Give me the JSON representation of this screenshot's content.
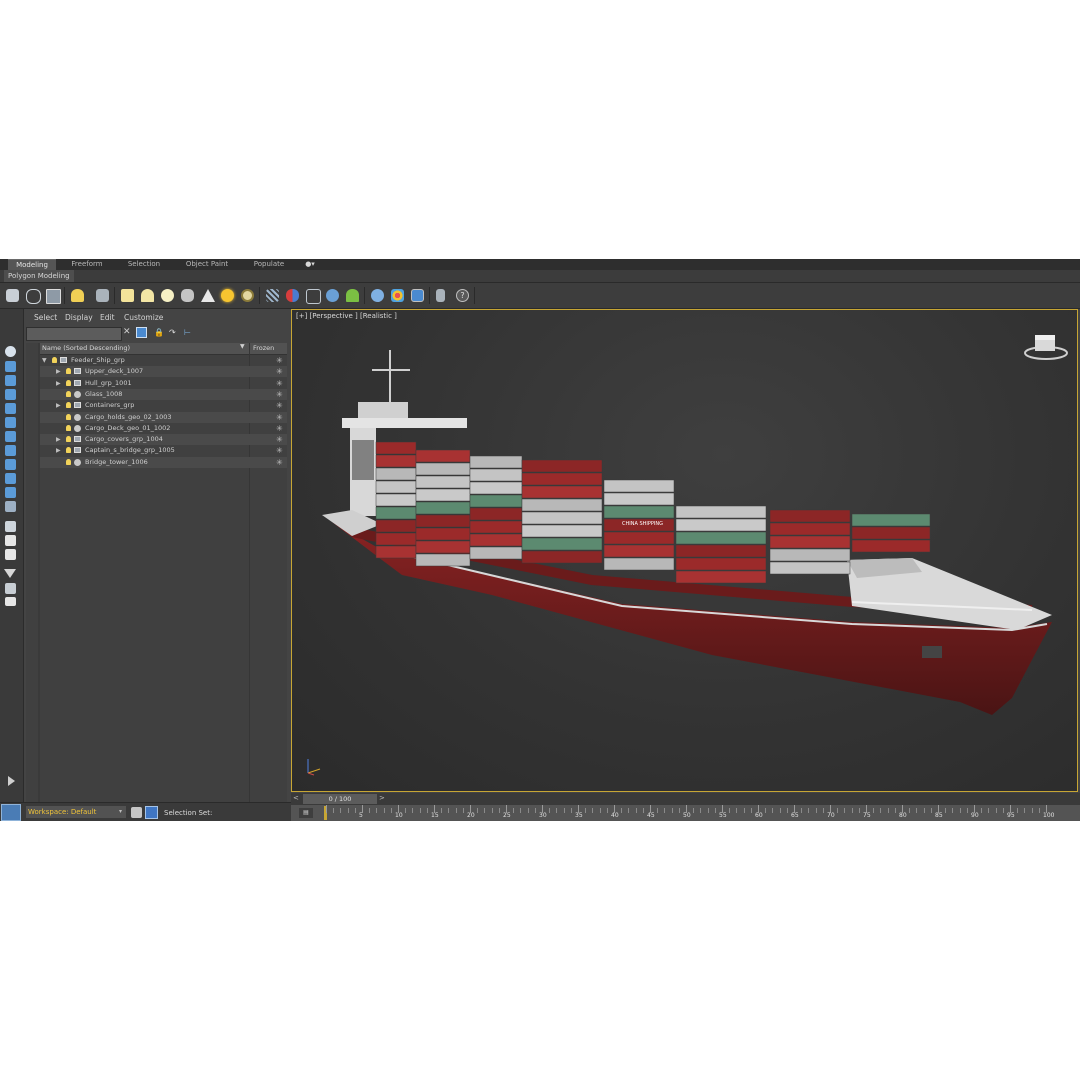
{
  "ribbon": {
    "tabs": [
      {
        "label": "Modeling",
        "active": true
      },
      {
        "label": "Freeform",
        "active": false
      },
      {
        "label": "Selection",
        "active": false
      },
      {
        "label": "Object Paint",
        "active": false
      },
      {
        "label": "Populate",
        "active": false
      }
    ],
    "subpanel": "Polygon Modeling"
  },
  "toolbar": {
    "icons": [
      "teapot-icon",
      "cloud-icon",
      "render-frame-icon",
      "light-bulb-icon",
      "ladder-icon",
      "box-icon",
      "dome-icon",
      "sphere-icon",
      "teapot-icon",
      "cone-icon",
      "sun-icon",
      "circle-icon",
      "particles-icon",
      "capsule-icon",
      "network-icon",
      "globe-icon",
      "plant-icon",
      "material-ball-icon",
      "palette-icon",
      "render-icon",
      "phone-icon",
      "help-icon"
    ],
    "help_glyph": "?"
  },
  "explorer": {
    "menu": [
      "Select",
      "Display",
      "Edit",
      "Customize"
    ],
    "columns": {
      "name": "Name (Sorted Descending)",
      "frozen": "Frozen"
    },
    "rows": [
      {
        "name": "Feeder_Ship_grp",
        "level": 0,
        "expanded": true,
        "type": "group"
      },
      {
        "name": "Upper_deck_1007",
        "level": 1,
        "expanded": false,
        "type": "group"
      },
      {
        "name": "Hull_grp_1001",
        "level": 1,
        "expanded": false,
        "type": "group"
      },
      {
        "name": "Glass_1008",
        "level": 1,
        "expanded": null,
        "type": "object"
      },
      {
        "name": "Containers_grp",
        "level": 1,
        "expanded": false,
        "type": "group"
      },
      {
        "name": "Cargo_holds_geo_02_1003",
        "level": 1,
        "expanded": null,
        "type": "object"
      },
      {
        "name": "Cargo_Deck_geo_01_1002",
        "level": 1,
        "expanded": null,
        "type": "object"
      },
      {
        "name": "Cargo_covers_grp_1004",
        "level": 1,
        "expanded": false,
        "type": "group"
      },
      {
        "name": "Captain_s_bridge_grp_1005",
        "level": 1,
        "expanded": false,
        "type": "group"
      },
      {
        "name": "Bridge_tower_1006",
        "level": 1,
        "expanded": null,
        "type": "object"
      }
    ]
  },
  "viewport": {
    "label": "[+] [Perspective ] [Realistic ]",
    "container_text": "CHINA SHIPPING",
    "hull_color": "#7a1e1e",
    "accent_color": "#c7a634"
  },
  "timeline": {
    "frame": "0 / 100",
    "ticks": [
      "5",
      "10",
      "15",
      "20",
      "25",
      "30",
      "35",
      "40",
      "45",
      "50",
      "55",
      "60",
      "65",
      "70",
      "75",
      "80",
      "85",
      "90",
      "95",
      "100"
    ]
  },
  "status": {
    "workspace": "Workspace: Default",
    "selection_set": "Selection Set:"
  }
}
